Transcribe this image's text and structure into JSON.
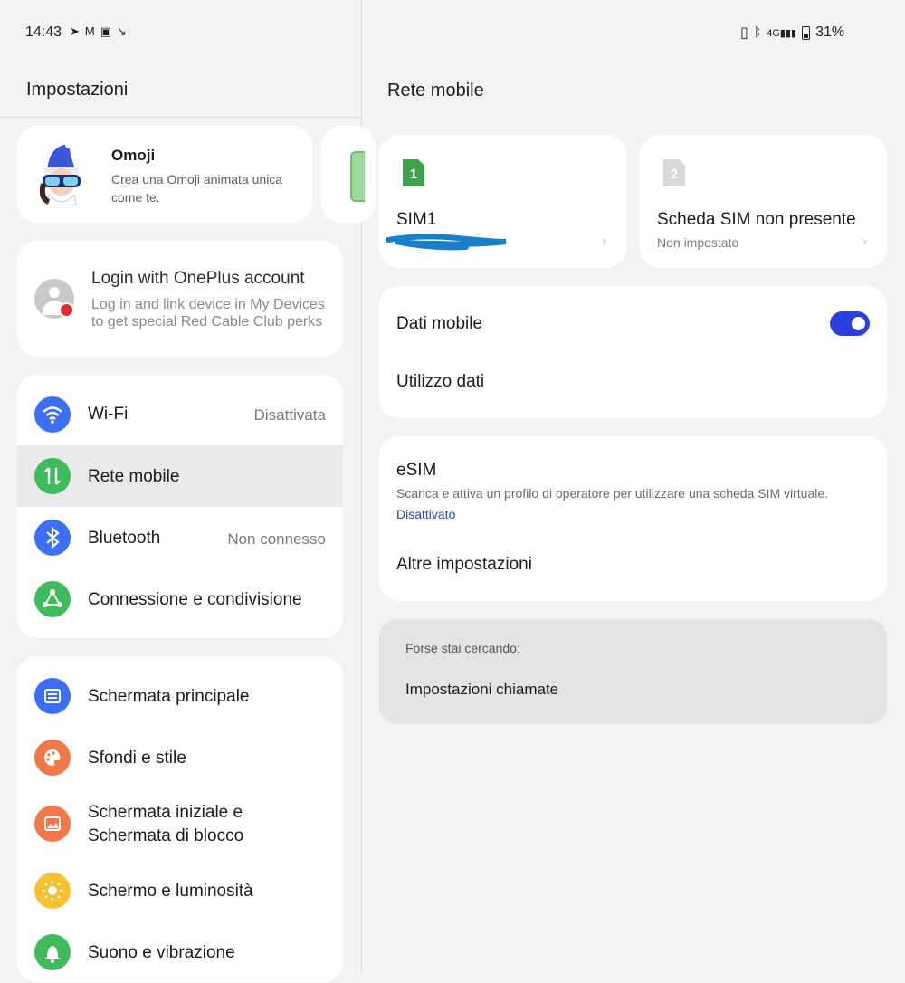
{
  "status_bar": {
    "time": "14:43",
    "left_icons": [
      "telegram-icon",
      "gmail-icon",
      "media-icon",
      "missed-call-icon"
    ],
    "right_icons": [
      "vibrate-icon",
      "bluetooth-icon",
      "signal-4g-icon"
    ],
    "battery": "31%"
  },
  "left_pane": {
    "title": "Impostazioni",
    "omoji": {
      "title": "Omoji",
      "description": "Crea una Omoji animata unica come te."
    },
    "login": {
      "title": "Login with OnePlus account",
      "description": "Log in and link device in My Devices to get special Red Cable Club perks"
    },
    "connectivity": [
      {
        "label": "Wi-Fi",
        "value": "Disattivata",
        "icon": "wifi-icon",
        "color": "#3d6ff5"
      },
      {
        "label": "Rete mobile",
        "value": "",
        "icon": "mobile-data-icon",
        "color": "#3fba5c"
      },
      {
        "label": "Bluetooth",
        "value": "Non connesso",
        "icon": "bluetooth-icon",
        "color": "#3d6ff5"
      },
      {
        "label": "Connessione e condivisione",
        "value": "",
        "icon": "share-icon",
        "color": "#3fba5c"
      }
    ],
    "display": [
      {
        "label": "Schermata principale",
        "icon": "home-screen-icon",
        "color": "#3d6ff5"
      },
      {
        "label": "Sfondi e stile",
        "icon": "palette-icon",
        "color": "#f0784a"
      },
      {
        "label": "Schermata iniziale e",
        "label2": "Schermata di blocco",
        "icon": "lock-screen-icon",
        "color": "#f0784a"
      },
      {
        "label": "Schermo e luminosità",
        "icon": "brightness-icon",
        "color": "#f5c12e"
      },
      {
        "label": "Suono e vibrazione",
        "icon": "sound-icon",
        "color": "#3fba5c"
      }
    ]
  },
  "right_pane": {
    "title": "Rete mobile",
    "sim1": {
      "slot": "1",
      "name": "SIM1"
    },
    "sim2": {
      "slot": "2",
      "name": "Scheda SIM non presente",
      "status": "Non impostato"
    },
    "dati_mobile": {
      "label": "Dati mobile",
      "enabled": true
    },
    "utilizzo_dati": "Utilizzo dati",
    "esim": {
      "title": "eSIM",
      "description": "Scarica e attiva un profilo di operatore per utilizzare una scheda SIM virtuale.",
      "status": "Disattivato"
    },
    "altre_impostazioni": "Altre impostazioni",
    "suggestions": {
      "label": "Forse stai cercando:",
      "item": "Impostazioni chiamate"
    }
  },
  "colors": {
    "accent": "#2b3fdd",
    "link": "#2446c8",
    "sim_green": "#3fa34d"
  }
}
